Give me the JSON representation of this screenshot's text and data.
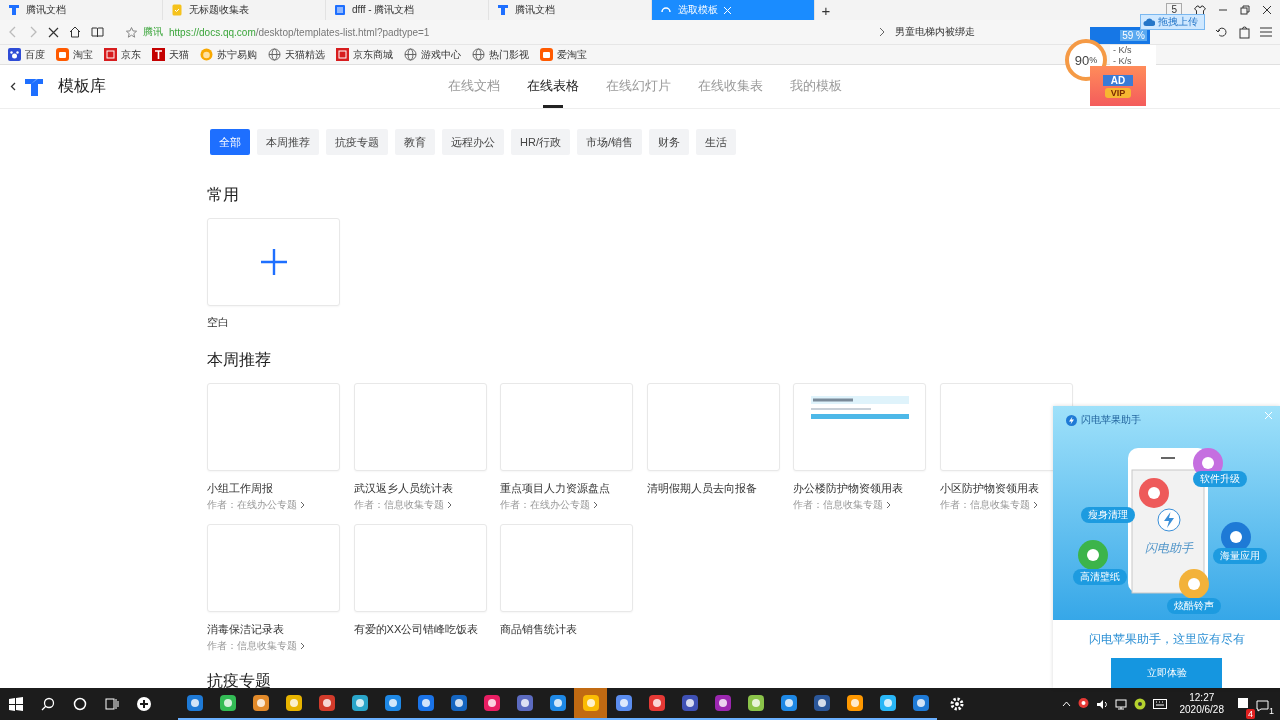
{
  "browser": {
    "tabs": [
      {
        "title": "腾讯文档",
        "kind": "docs",
        "selected": false
      },
      {
        "title": "无标题收集表",
        "kind": "form",
        "selected": false
      },
      {
        "title": "dfff - 腾讯文档",
        "kind": "sheet",
        "selected": false
      },
      {
        "title": "腾讯文档",
        "kind": "docs",
        "selected": false
      },
      {
        "title": "选取模板",
        "kind": "loading",
        "selected": true
      }
    ],
    "new_tab": "+",
    "tab_count": "5",
    "address": {
      "site_label": "腾讯",
      "url_host": "https://docs.qq.com",
      "url_path": "/desktop/templates-list.html?padtype=1"
    },
    "news": "男童电梯内被绑走",
    "bookmarks": [
      {
        "label": "百度",
        "kind": "paw"
      },
      {
        "label": "淘宝",
        "kind": "tao"
      },
      {
        "label": "京东",
        "kind": "jd"
      },
      {
        "label": "天猫",
        "kind": "tmall"
      },
      {
        "label": "苏宁易购",
        "kind": "lion"
      },
      {
        "label": "天猫精选",
        "kind": "globe"
      },
      {
        "label": "京东商城",
        "kind": "jd"
      },
      {
        "label": "游戏中心",
        "kind": "globe"
      },
      {
        "label": "热门影视",
        "kind": "globe"
      },
      {
        "label": "爱淘宝",
        "kind": "tao"
      }
    ]
  },
  "overlay": {
    "speed": "90",
    "speed_unit": "%",
    "upload": "- K/s",
    "download": "- K/s",
    "battery": "59 %",
    "upload_tip": "拖拽上传",
    "ad": "AD",
    "vip": "VIP"
  },
  "page": {
    "title": "模板库",
    "nav": [
      {
        "label": "在线文档",
        "selected": false
      },
      {
        "label": "在线表格",
        "selected": true
      },
      {
        "label": "在线幻灯片",
        "selected": false
      },
      {
        "label": "在线收集表",
        "selected": false
      },
      {
        "label": "我的模板",
        "selected": false
      }
    ],
    "categories": [
      {
        "label": "全部",
        "selected": true
      },
      {
        "label": "本周推荐",
        "selected": false
      },
      {
        "label": "抗疫专题",
        "selected": false
      },
      {
        "label": "教育",
        "selected": false
      },
      {
        "label": "远程办公",
        "selected": false
      },
      {
        "label": "HR/行政",
        "selected": false
      },
      {
        "label": "市场/销售",
        "selected": false
      },
      {
        "label": "财务",
        "selected": false
      },
      {
        "label": "生活",
        "selected": false
      }
    ],
    "sections": [
      {
        "title": "常用",
        "items": [
          {
            "kind": "blank",
            "title": "空白"
          }
        ]
      },
      {
        "title": "本周推荐",
        "items": [
          {
            "kind": "template",
            "title": "小组工作周报",
            "author_label": "作者：",
            "author": "在线办公专题"
          },
          {
            "kind": "template",
            "title": "武汉返乡人员统计表",
            "author_label": "作者：",
            "author": "信息收集专题"
          },
          {
            "kind": "template",
            "title": "重点项目人力资源盘点",
            "author_label": "作者：",
            "author": "在线办公专题"
          },
          {
            "kind": "template",
            "title": "清明假期人员去向报备"
          },
          {
            "kind": "preview",
            "title": "办公楼防护物资领用表",
            "author_label": "作者：",
            "author": "信息收集专题"
          },
          {
            "kind": "template",
            "title": "小区防护物资领用表",
            "author_label": "作者：",
            "author": "信息收集专题"
          },
          {
            "kind": "template",
            "title": "消毒保洁记录表",
            "author_label": "作者：",
            "author": "信息收集专题"
          },
          {
            "kind": "template",
            "title": "有爱的XX公司错峰吃饭表"
          },
          {
            "kind": "template",
            "title": "商品销售统计表"
          }
        ]
      },
      {
        "title": "抗疫专题"
      }
    ]
  },
  "popup": {
    "brand": "闪电苹果助手",
    "phone_logo": "闪电助手",
    "features": [
      "软件升级",
      "瘦身清理",
      "海量应用",
      "高清壁纸",
      "炫酷铃声"
    ],
    "caption": "闪电苹果助手，这里应有尽有",
    "button": "立即体验"
  },
  "taskbar": {
    "apps": [
      {
        "selected": false
      },
      {
        "selected": false
      },
      {
        "selected": false
      },
      {
        "selected": false
      },
      {
        "selected": false
      },
      {
        "selected": false
      },
      {
        "selected": false
      },
      {
        "selected": false
      },
      {
        "selected": false
      },
      {
        "selected": false
      },
      {
        "selected": false
      },
      {
        "selected": false
      },
      {
        "selected": true
      },
      {
        "selected": false
      },
      {
        "selected": false
      },
      {
        "selected": false
      },
      {
        "selected": false
      },
      {
        "selected": false
      },
      {
        "selected": false
      },
      {
        "selected": false
      },
      {
        "selected": false
      },
      {
        "selected": false
      },
      {
        "selected": false
      }
    ],
    "tray_badge": "4",
    "notification_count": "1",
    "time": "12:27",
    "date": "2020/6/28"
  }
}
